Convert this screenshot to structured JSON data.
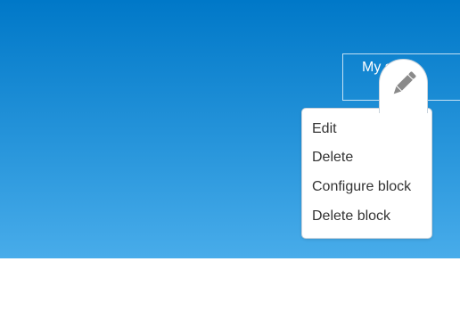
{
  "site": {
    "name": "My site."
  },
  "edit_trigger": {
    "icon": "pencil-icon"
  },
  "contextual_menu": {
    "items": [
      {
        "label": "Edit"
      },
      {
        "label": "Delete"
      },
      {
        "label": "Configure block"
      },
      {
        "label": "Delete block"
      }
    ]
  },
  "colors": {
    "header_top": "#0078c8",
    "header_bottom": "#48acea",
    "menu_text": "#333333",
    "icon": "#8a8a8a"
  }
}
